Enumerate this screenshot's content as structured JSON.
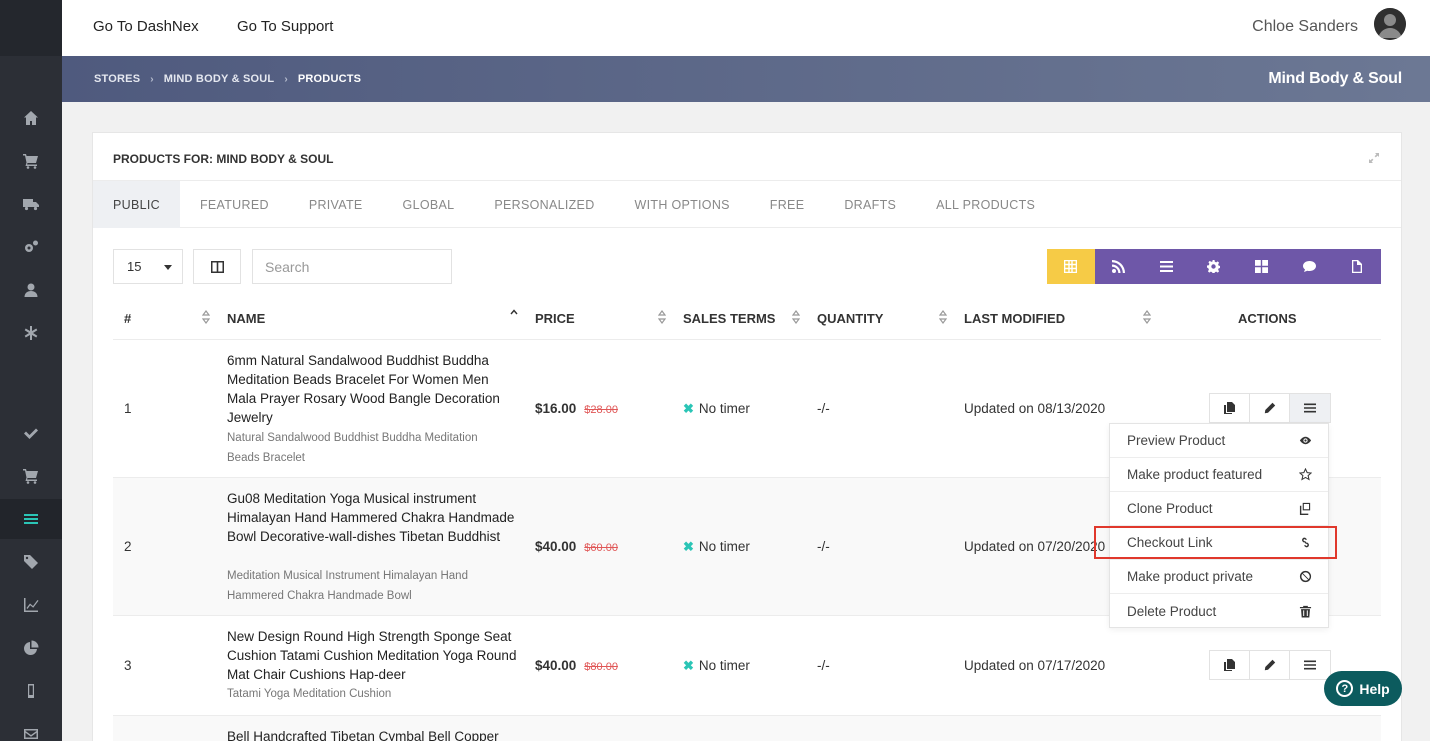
{
  "topbar": {
    "link1": "Go To DashNex",
    "link2": "Go To Support",
    "user_name": "Chloe Sanders"
  },
  "breadcrumb": {
    "items": [
      "STORES",
      "MIND BODY & SOUL",
      "PRODUCTS"
    ],
    "store_title": "Mind Body & Soul"
  },
  "panel": {
    "title": "PRODUCTS FOR: MIND BODY & SOUL",
    "tabs": [
      "PUBLIC",
      "FEATURED",
      "PRIVATE",
      "GLOBAL",
      "PERSONALIZED",
      "WITH OPTIONS",
      "FREE",
      "DRAFTS",
      "ALL PRODUCTS"
    ],
    "active_tab": "PUBLIC"
  },
  "controls": {
    "per_page": "15",
    "search_placeholder": "Search"
  },
  "view_buttons": [
    "table-icon",
    "rss-icon",
    "list-icon",
    "gear-icon",
    "grid-icon",
    "comment-icon",
    "file-icon"
  ],
  "table": {
    "headers": [
      "#",
      "NAME",
      "PRICE",
      "SALES TERMS",
      "QUANTITY",
      "LAST MODIFIED",
      "ACTIONS"
    ],
    "rows": [
      {
        "num": "1",
        "name": "6mm Natural Sandalwood Buddhist Buddha Meditation Beads Bracelet For Women Men Mala Prayer Rosary Wood Bangle Decoration Jewelry",
        "sub": "Natural Sandalwood Buddhist Buddha Meditation Beads Bracelet",
        "price": "$16.00",
        "old_price": "$28.00",
        "terms": "No timer",
        "qty": "-/-",
        "modified": "Updated on 08/13/2020"
      },
      {
        "num": "2",
        "name": "Gu08 Meditation Yoga Musical instrument Himalayan Hand Hammered Chakra Handmade Bowl Decorative-wall-dishes Tibetan Buddhist",
        "sub": "Meditation Musical Instrument Himalayan Hand Hammered Chakra Handmade Bowl",
        "price": "$40.00",
        "old_price": "$60.00",
        "terms": "No timer",
        "qty": "-/-",
        "modified": "Updated on 07/20/2020"
      },
      {
        "num": "3",
        "name": "New Design Round High Strength Sponge Seat Cushion Tatami Cushion Meditation Yoga Round Mat Chair Cushions Hap-deer",
        "sub": "Tatami Yoga Meditation Cushion",
        "price": "$40.00",
        "old_price": "$80.00",
        "terms": "No timer",
        "qty": "-/-",
        "modified": "Updated on 07/17/2020"
      },
      {
        "num": "",
        "name": "Bell Handcrafted Tibetan Cymbal Bell Copper",
        "sub": "",
        "price": "",
        "old_price": "",
        "terms": "",
        "qty": "",
        "modified": ""
      }
    ]
  },
  "dropdown": {
    "items": [
      {
        "label": "Preview Product",
        "icon": "eye-icon"
      },
      {
        "label": "Make product featured",
        "icon": "star-icon"
      },
      {
        "label": "Clone Product",
        "icon": "copy-icon"
      },
      {
        "label": "Checkout Link",
        "icon": "link-icon"
      },
      {
        "label": "Make product private",
        "icon": "ban-icon"
      },
      {
        "label": "Delete Product",
        "icon": "trash-icon"
      }
    ]
  },
  "help": {
    "label": "Help"
  },
  "colors": {
    "sidebar": "#2c2f36",
    "accent_teal": "#2bc5b6",
    "view_purple": "#6e57a8",
    "view_active_yellow": "#f6cb46",
    "highlight_red": "#e0382c",
    "help_bg": "#0c5b5e"
  }
}
